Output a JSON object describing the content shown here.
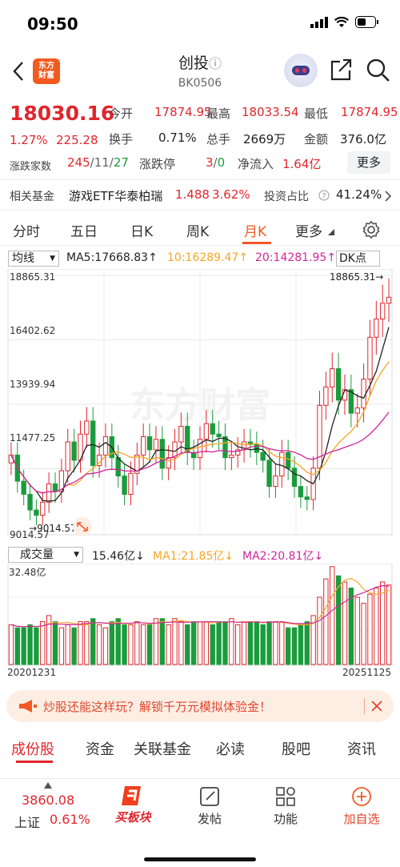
{
  "status_bar": {
    "time": "09:50"
  },
  "header": {
    "title": "创投",
    "info_icon": "ⓘ",
    "code": "BK0506",
    "logo_text": "东方\n财富"
  },
  "quote": {
    "price": "18030.16",
    "change_pct": "1.27%",
    "change_val": "225.28",
    "open_label": "今开",
    "open_val": "17874.95",
    "high_label": "最高",
    "high_val": "18033.54",
    "low_label": "最低",
    "low_val": "17874.95",
    "turnover_label": "换手",
    "turnover_val": "0.71%",
    "volume_label": "总手",
    "volume_val": "2669万",
    "amount_label": "金额",
    "amount_val": "376.0亿",
    "breadth_label": "涨跌家数",
    "breadth_up": "245",
    "breadth_flat": "/11/",
    "breadth_down": "27",
    "limit_label": "涨跌停",
    "limit_up": "3",
    "limit_sep": "/",
    "limit_down": "0",
    "inflow_label": "净流入",
    "inflow_val": "1.64亿",
    "more_label": "更多"
  },
  "fund": {
    "label": "相关基金",
    "name": "游戏ETF华泰柏瑞",
    "price": "1.488",
    "pct": "3.62%",
    "ratio_label": "投资占比",
    "ratio_val": "41.24%"
  },
  "chart_tabs": [
    "分时",
    "五日",
    "日K",
    "周K",
    "月K",
    "更多"
  ],
  "active_tab": "月K",
  "kline": {
    "indicator": "均线",
    "ma5": "MA5:17668.83↑",
    "ma10": "10:16289.47↑",
    "ma20": "20:14281.95↑",
    "dk_label": "DK点",
    "y_labels": [
      "18865.31",
      "16402.62",
      "13939.94",
      "11477.25",
      "9014.57"
    ],
    "max_label": "18865.31→",
    "min_label": "9014.57",
    "watermark": "东方财富"
  },
  "volume": {
    "indicator": "成交量",
    "value": "15.46亿↓",
    "ma1": "MA1:21.85亿↓",
    "ma2": "MA2:20.81亿↓",
    "y_top": "32.48亿",
    "date_start": "20201231",
    "date_end": "20251125"
  },
  "chart_data": {
    "type": "candlestick",
    "period": "monthly",
    "ylim": [
      9014.57,
      18865.31
    ],
    "start": "20201231",
    "end": "20251125",
    "closes": [
      12000,
      11000,
      10500,
      9900,
      9700,
      10200,
      10900,
      10600,
      11400,
      12500,
      11800,
      12800,
      13300,
      11600,
      12000,
      12700,
      11900,
      11200,
      10500,
      11300,
      12000,
      12700,
      12200,
      12600,
      11500,
      11900,
      12500,
      13100,
      12100,
      11900,
      12600,
      13200,
      12800,
      12700,
      11900,
      12000,
      12200,
      12500,
      12400,
      12100,
      11800,
      10800,
      11200,
      12100,
      11500,
      10800,
      10400,
      10300,
      11500,
      13900,
      14600,
      15300,
      14100,
      14500,
      13600,
      13800,
      14900,
      16500,
      17200,
      17800,
      18030
    ],
    "volumes": [
      13,
      12,
      12,
      13,
      12,
      14,
      16,
      14,
      12,
      13,
      12,
      14,
      14,
      15,
      13,
      12,
      14,
      15,
      13,
      13,
      14,
      13,
      13,
      15,
      15,
      13,
      15,
      14,
      13,
      14,
      14,
      14,
      13,
      14,
      14,
      15,
      13,
      14,
      14,
      14,
      13,
      14,
      14,
      14,
      12,
      12,
      13,
      14,
      16,
      22,
      28,
      32,
      29,
      27,
      25,
      22,
      20,
      23,
      25,
      27,
      26,
      17,
      15
    ]
  },
  "banner": {
    "text": "炒股还能这样玩？解锁千万元模拟体验金！"
  },
  "bottom_tabs": [
    "成份股",
    "资金",
    "关联基金",
    "必读",
    "股吧",
    "资讯"
  ],
  "bottom_nav": {
    "index_val": "3860.08",
    "index_name": "上证",
    "index_pct": "0.61%",
    "items": [
      "买板块",
      "发帖",
      "功能",
      "加自选"
    ]
  },
  "colors": {
    "up": "#e0262d",
    "down": "#1a9c3c",
    "accent": "#f05a24",
    "ma5": "#222222",
    "ma10": "#f5a623",
    "ma20": "#d0269a"
  }
}
